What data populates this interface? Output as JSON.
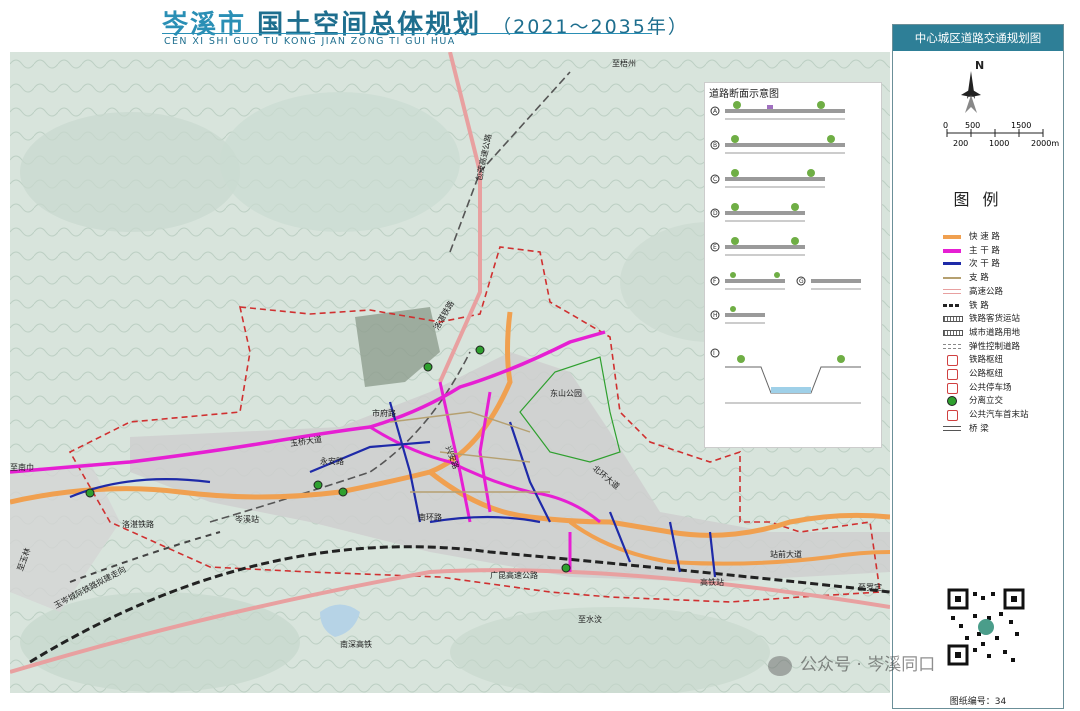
{
  "header": {
    "title_city": "岑溪市",
    "title_rest": "国土空间总体规划",
    "title_years": "（2021～2035年）",
    "pinyin": "CEN XI SHI   GUO TU KONG JIAN ZONG TI GUI HUA"
  },
  "sidebar": {
    "map_name": "中心城区道路交通规划图",
    "north_label": "N",
    "scale_top": [
      "0",
      "500",
      "1500"
    ],
    "scale_bottom": [
      "200",
      "1000",
      "2000m"
    ],
    "legend_title": "图 例",
    "legend": [
      {
        "label": "快 速 路",
        "color": "#f0a050",
        "style": "thick"
      },
      {
        "label": "主 干 路",
        "color": "#e61fd3",
        "style": "thick"
      },
      {
        "label": "次 干 路",
        "color": "#1e2aa8",
        "style": "mid"
      },
      {
        "label": "支    路",
        "color": "#b5a070",
        "style": "thin"
      },
      {
        "label": "高速公路",
        "color": "#e8a0a0",
        "style": "double"
      },
      {
        "label": "铁    路",
        "color": "#222222",
        "style": "rail"
      },
      {
        "label": "铁路客货运站",
        "color": "#555555",
        "style": "hatch"
      },
      {
        "label": "城市道路用地",
        "color": "#555555",
        "style": "hatch"
      },
      {
        "label": "弹性控制道路",
        "color": "#888888",
        "style": "dash"
      },
      {
        "label": "铁路枢纽",
        "color": "#d04040",
        "style": "icon"
      },
      {
        "label": "公路枢纽",
        "color": "#d04040",
        "style": "icon"
      },
      {
        "label": "公共停车场",
        "color": "#d04040",
        "style": "icon"
      },
      {
        "label": "分离立交",
        "color": "#2fa02f",
        "style": "dot"
      },
      {
        "label": "公共汽车首末站",
        "color": "#d04040",
        "style": "icon"
      },
      {
        "label": "桥    梁",
        "color": "#555555",
        "style": "bridge"
      }
    ],
    "sheet_number": "图纸编号：34"
  },
  "inset": {
    "title": "道路断面示意图",
    "sections": [
      "A",
      "B",
      "C",
      "D",
      "E",
      "F",
      "G",
      "H",
      "I"
    ]
  },
  "map_labels": {
    "to_cenxi_north": "至梧州",
    "baomao": "包茂高速公路",
    "luozhan": "洛湛铁路",
    "yuqiao": "玉桥大道",
    "shifu": "市府路",
    "dongshan": "东山公园",
    "beihuan": "北环大道",
    "nanhuan": "南环路",
    "cenxi_station": "岑溪站",
    "gaotie": "高铁站",
    "zhanqian": "站前大道",
    "guangkun": "广昆高速公路",
    "yucen": "玉岑城际铁路拟建走向",
    "nanshen": "南深高铁",
    "to_shuiwen": "至水汶",
    "to_luoding": "至罗定",
    "to_nandu": "至南巾",
    "zhilin": "至玉林",
    "yongan": "永安路",
    "xinan": "兴安路"
  },
  "watermark": "公众号 · 岑溪同口"
}
